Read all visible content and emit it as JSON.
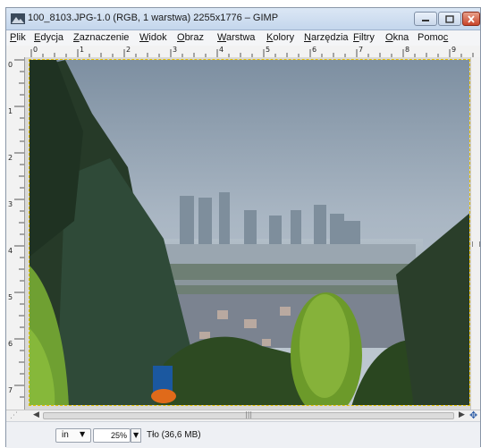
{
  "window": {
    "title": "100_8103.JPG-1.0 (RGB, 1 warstwa) 2255x1776 – GIMP",
    "controls": {
      "minimize": "–",
      "maximize": "□",
      "close": "✕"
    }
  },
  "menubar": {
    "items": [
      {
        "label": "Plik",
        "mnemonic": "P",
        "rest": "lik"
      },
      {
        "label": "Edycja",
        "mnemonic": "E",
        "rest": "dycja"
      },
      {
        "label": "Zaznaczenie",
        "mnemonic": "Z",
        "rest": "aznaczenie"
      },
      {
        "label": "Widok",
        "mnemonic": "W",
        "rest": "idok"
      },
      {
        "label": "Obraz",
        "mnemonic": "O",
        "rest": "braz"
      },
      {
        "label": "Warstwa",
        "mnemonic": "W",
        "rest": "arstwa"
      },
      {
        "label": "Kolory",
        "mnemonic": "K",
        "rest": "olory"
      },
      {
        "label": "Narzędzia",
        "mnemonic": "N",
        "rest": "arzędzia"
      },
      {
        "label": "Filtry",
        "mnemonic": "F",
        "rest": "iltry"
      },
      {
        "label": "Okna",
        "mnemonic": "O",
        "rest": "kna"
      },
      {
        "label": "Pomoc",
        "prefix": "Pomo",
        "mnemonic": "c"
      }
    ]
  },
  "rulers": {
    "top_ticks": [
      "0",
      "1",
      "2",
      "3",
      "4",
      "5",
      "6",
      "7",
      "8",
      "9"
    ],
    "left_ticks": [
      "0",
      "1",
      "2",
      "3",
      "4",
      "5",
      "6",
      "7"
    ]
  },
  "statusbar": {
    "unit": "in",
    "zoom": "25%",
    "layer_info": "Tło (36,6 MB)"
  },
  "icons": {
    "app": "gimp-image-icon",
    "scroll_left": "arrow-left-icon",
    "scroll_right": "arrow-right-icon",
    "navigate": "navigate-icon"
  }
}
